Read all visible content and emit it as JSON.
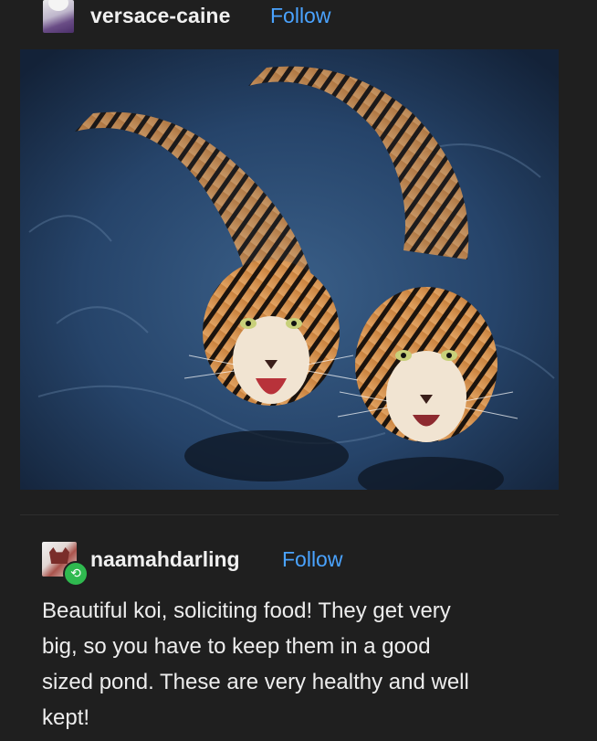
{
  "posts": [
    {
      "username": "versace-caine",
      "follow_label": "Follow",
      "image_subject": "two tigers swimming"
    },
    {
      "username": "naamahdarling",
      "follow_label": "Follow",
      "reblog_icon": "reblog-icon",
      "body_lines": [
        "Beautiful koi, soliciting food! They get very",
        "big, so you have to keep them in a good",
        "sized pond. These are very healthy and well",
        "kept!"
      ]
    }
  ],
  "colors": {
    "background": "#1f1f1f",
    "link": "#4aa3ff",
    "reblog_badge": "#2fb94f",
    "text": "#ededed"
  }
}
